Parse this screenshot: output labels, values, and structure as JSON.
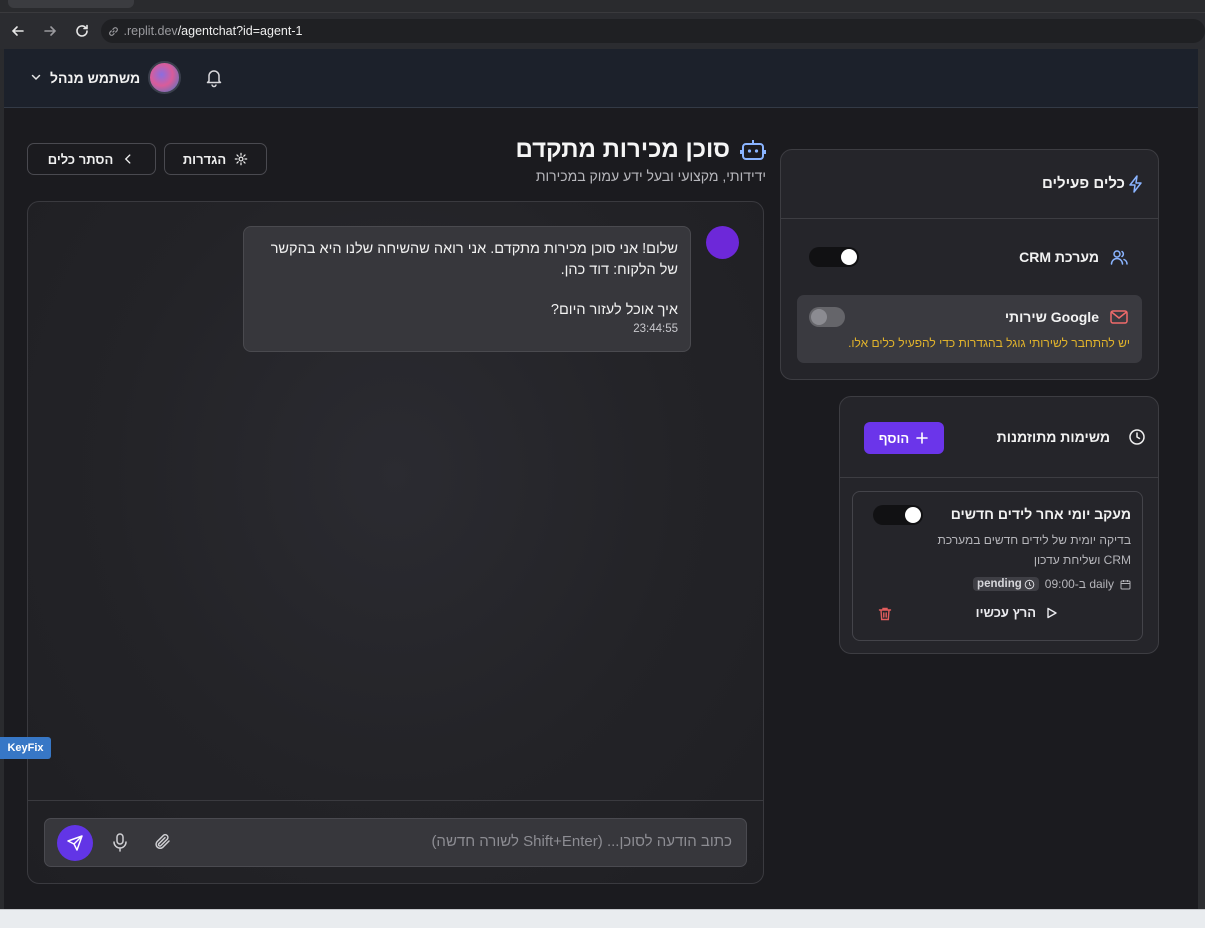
{
  "browser": {
    "url_host": ".replit.dev",
    "url_path": "/agentchat?id=agent-1"
  },
  "header": {
    "user_name": "משתמש מנהל"
  },
  "agent": {
    "title": "סוכן מכירות מתקדם",
    "subtitle": "ידידותי, מקצועי ובעל ידע עמוק במכירות",
    "settings_label": "הגדרות",
    "hide_tools_label": "הסתר כלים"
  },
  "chat": {
    "messages": [
      {
        "line1": "שלום! אני סוכן מכירות מתקדם. אני רואה שהשיחה שלנו היא בהקשר",
        "line2": "של הלקוח: דוד כהן.",
        "line3": "איך אוכל לעזור היום?",
        "time": "23:44:55"
      }
    ],
    "input_placeholder": "כתוב הודעה לסוכן... (Shift+Enter לשורה חדשה)"
  },
  "overlay": {
    "keyfix": "KeyFix"
  },
  "tools": {
    "title": "כלים פעילים",
    "items": [
      {
        "name": "מערכת CRM",
        "enabled": true
      },
      {
        "name": "שירותי Google",
        "enabled": false,
        "warning": "יש להתחבר לשירותי גוגל בהגדרות כדי להפעיל כלים אלו."
      }
    ]
  },
  "scheduled": {
    "title": "משימות מתוזמנות",
    "add_label": "הוסף",
    "tasks": [
      {
        "title": "מעקב יומי אחר לידים חדשים",
        "desc_line1": "בדיקה יומית של לידים חדשים במערכת",
        "desc_line2": "CRM ושליחת עדכון",
        "schedule": "daily ב-09:00",
        "status": "pending",
        "run_label": "הרץ עכשיו",
        "enabled": true
      }
    ]
  },
  "colors": {
    "accent": "#6b35ea",
    "bot_avatar": "#6d28d9",
    "warning": "#e1b32b",
    "delete": "#e35d5d"
  }
}
